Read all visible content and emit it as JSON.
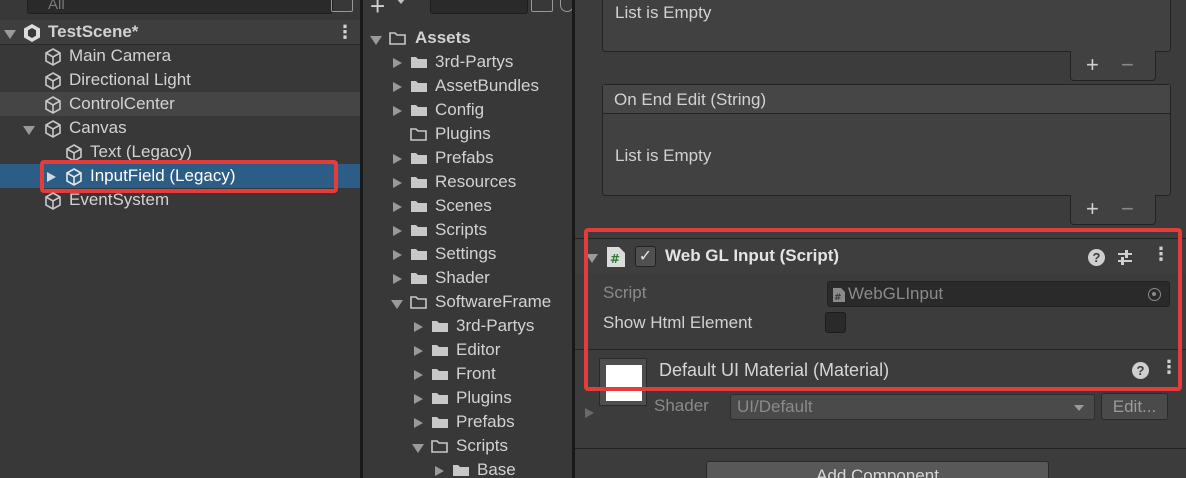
{
  "hierarchy": {
    "search_placeholder": "All",
    "scene_title": "TestScene*",
    "items": [
      {
        "label": "Main Camera"
      },
      {
        "label": "Directional Light"
      },
      {
        "label": "ControlCenter"
      },
      {
        "label": "Canvas"
      },
      {
        "label": "Text (Legacy)"
      },
      {
        "label": "InputField (Legacy)"
      },
      {
        "label": "EventSystem"
      }
    ]
  },
  "project": {
    "add_label": "+",
    "root": "Assets",
    "folders": [
      {
        "label": "3rd-Partys"
      },
      {
        "label": "AssetBundles"
      },
      {
        "label": "Config"
      },
      {
        "label": "Plugins"
      },
      {
        "label": "Prefabs"
      },
      {
        "label": "Resources"
      },
      {
        "label": "Scenes"
      },
      {
        "label": "Scripts"
      },
      {
        "label": "Settings"
      },
      {
        "label": "Shader"
      },
      {
        "label": "SoftwareFrame"
      },
      {
        "label": "3rd-Partys"
      },
      {
        "label": "Editor"
      },
      {
        "label": "Front"
      },
      {
        "label": "Plugins"
      },
      {
        "label": "Prefabs"
      },
      {
        "label": "Scripts"
      },
      {
        "label": "Base"
      }
    ]
  },
  "inspector": {
    "event_list_top": {
      "empty_text": "List is Empty",
      "add": "+",
      "remove": "−"
    },
    "on_end_edit": {
      "title": "On End Edit (String)",
      "empty_text": "List is Empty",
      "add": "+",
      "remove": "−"
    },
    "component": {
      "title": "Web GL Input (Script)",
      "script_label": "Script",
      "script_value": "WebGLInput",
      "show_html_label": "Show Html Element",
      "show_html_checked": false,
      "enabled": true
    },
    "material": {
      "title": "Default UI Material (Material)",
      "shader_label": "Shader",
      "shader_value": "UI/Default",
      "edit_button": "Edit..."
    },
    "add_component_button": "Add Component"
  },
  "colors": {
    "selection": "#2c5d87",
    "highlight_red": "#e63b3b"
  }
}
